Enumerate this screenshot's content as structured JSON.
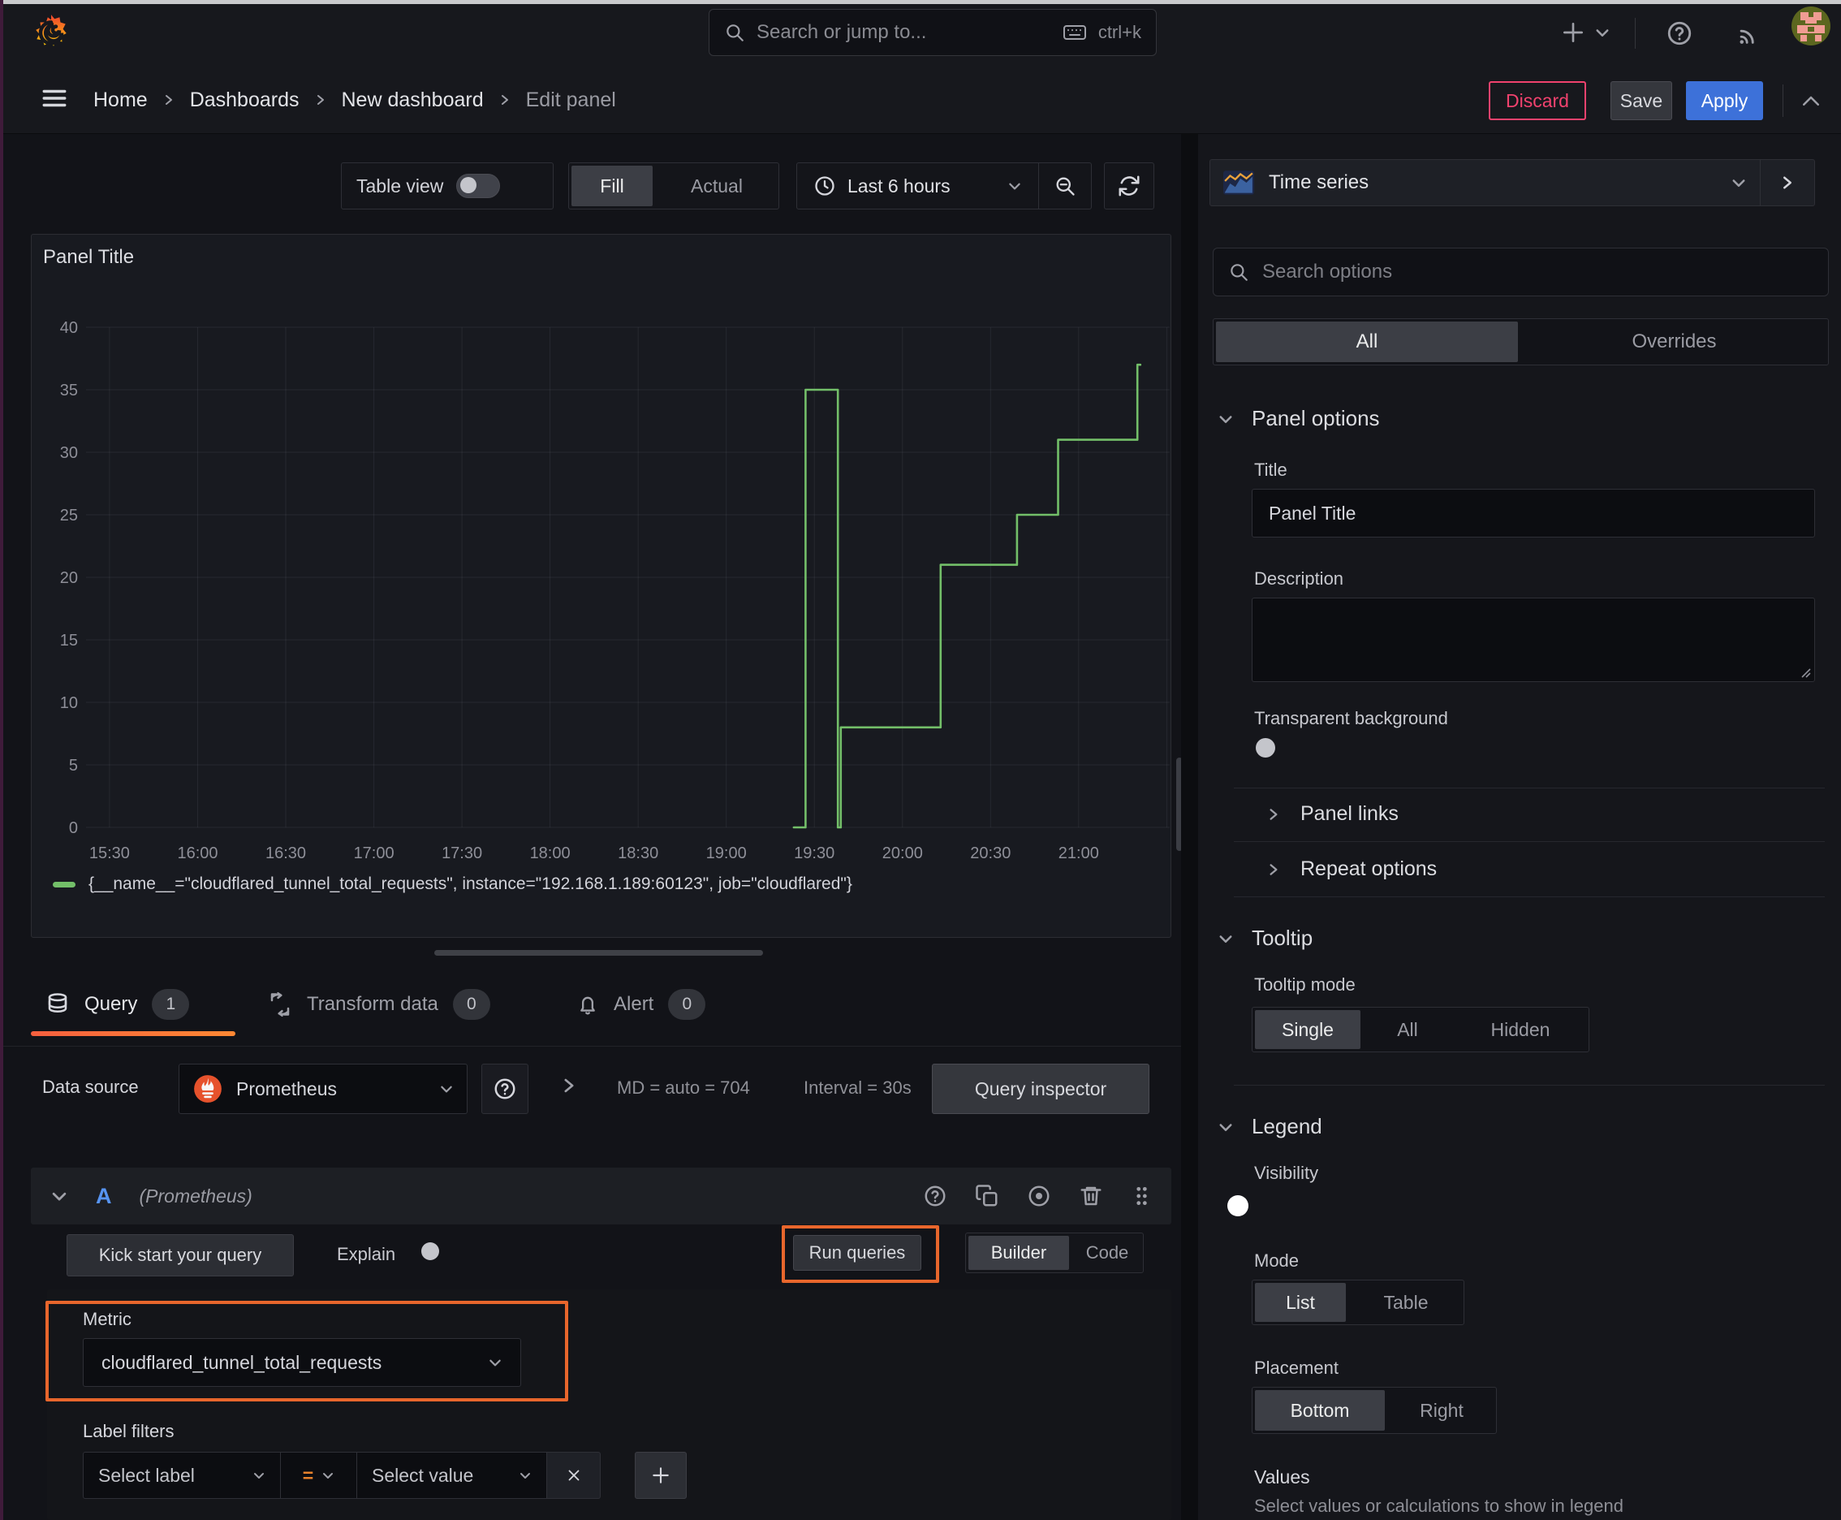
{
  "topbar": {
    "search_placeholder": "Search or jump to...",
    "search_shortcut": "ctrl+k"
  },
  "breadcrumb": {
    "items": [
      "Home",
      "Dashboards",
      "New dashboard"
    ],
    "current": "Edit panel",
    "discard": "Discard",
    "save": "Save",
    "apply": "Apply"
  },
  "toolbar": {
    "table_view": "Table view",
    "fill": "Fill",
    "actual": "Actual",
    "time_range": "Last 6 hours"
  },
  "panel": {
    "title": "Panel Title"
  },
  "chart_data": {
    "type": "line",
    "line_mode": "step-after",
    "title": "Panel Title",
    "xlabel": "",
    "ylabel": "",
    "x_ticks": [
      "15:30",
      "16:00",
      "16:30",
      "17:00",
      "17:30",
      "18:00",
      "18:30",
      "19:00",
      "19:30",
      "20:00",
      "20:30",
      "21:00"
    ],
    "y_ticks": [
      0,
      5,
      10,
      15,
      20,
      25,
      30,
      35,
      40
    ],
    "ylim": [
      0,
      40
    ],
    "x_range_minutes": [
      922,
      1291
    ],
    "grid": true,
    "legend_position": "bottom",
    "series": [
      {
        "name": "{__name__=\"cloudflared_tunnel_total_requests\", instance=\"192.168.1.189:60123\", job=\"cloudflared\"}",
        "color": "#73bf69",
        "points": [
          [
            "19:23",
            0
          ],
          [
            "19:27",
            0
          ],
          [
            "19:27",
            35
          ],
          [
            "19:38",
            35
          ],
          [
            "19:38",
            0
          ],
          [
            "19:39",
            0
          ],
          [
            "19:39",
            8
          ],
          [
            "20:13",
            8
          ],
          [
            "20:13",
            21
          ],
          [
            "20:39",
            21
          ],
          [
            "20:39",
            25
          ],
          [
            "20:53",
            25
          ],
          [
            "20:53",
            31
          ],
          [
            "21:20",
            31
          ],
          [
            "21:20",
            37
          ],
          [
            "21:21",
            37
          ]
        ]
      }
    ]
  },
  "tabs": {
    "query": "Query",
    "query_count": "1",
    "transform": "Transform data",
    "transform_count": "0",
    "alert": "Alert",
    "alert_count": "0"
  },
  "datasource": {
    "label": "Data source",
    "name": "Prometheus",
    "stats_md": "MD = auto = 704",
    "stats_interval": "Interval = 30s",
    "inspector": "Query inspector"
  },
  "query": {
    "ref": "A",
    "ds_hint": "(Prometheus)",
    "kick": "Kick start your query",
    "explain": "Explain",
    "run": "Run queries",
    "builder": "Builder",
    "code": "Code",
    "metric_label": "Metric",
    "metric_value": "cloudflared_tunnel_total_requests",
    "label_filters": "Label filters",
    "select_label": "Select label",
    "op": "=",
    "select_value": "Select value"
  },
  "sidebar": {
    "viz": "Time series",
    "search_placeholder": "Search options",
    "tab_all": "All",
    "tab_overrides": "Overrides",
    "panel_options": {
      "header": "Panel options",
      "title_label": "Title",
      "title_value": "Panel Title",
      "description_label": "Description",
      "transparent": "Transparent background"
    },
    "collapsed": {
      "panel_links": "Panel links",
      "repeat_options": "Repeat options"
    },
    "tooltip": {
      "header": "Tooltip",
      "mode_label": "Tooltip mode",
      "single": "Single",
      "all": "All",
      "hidden": "Hidden"
    },
    "legend": {
      "header": "Legend",
      "visibility": "Visibility",
      "mode": "Mode",
      "list": "List",
      "table": "Table",
      "placement": "Placement",
      "bottom": "Bottom",
      "right": "Right",
      "values": "Values",
      "values_hint": "Select values or calculations to show in legend"
    }
  },
  "colors": {
    "accent_orange": "#e8662c",
    "tab_underline_from": "#f55f3e",
    "tab_underline_to": "#ff8833",
    "series_green": "#73bf69",
    "apply_blue": "#3d71d9",
    "discard_pink": "#f1426e",
    "query_ref_blue": "#5794f2",
    "prometheus_orange": "#e6522c"
  },
  "icons": {
    "grafana-logo": "flame-spiral",
    "search-icon": "magnifier",
    "keyboard-icon": "keyboard",
    "plus-icon": "plus",
    "help-icon": "question-circle",
    "rss-icon": "broadcast",
    "avatar": "pixel-avatar",
    "menu-icon": "hamburger",
    "clock-icon": "clock",
    "zoom-out-icon": "magnifier-minus",
    "refresh-icon": "sync-arrows",
    "database-icon": "cylinder",
    "transform-icon": "process-arrows",
    "bell-icon": "bell",
    "prometheus-icon": "torch",
    "copy-icon": "duplicate",
    "disable-query-icon": "circle-dot",
    "trash-icon": "trash",
    "drag-icon": "grip-dots",
    "timeseries-viz-icon": "mini-chart"
  }
}
